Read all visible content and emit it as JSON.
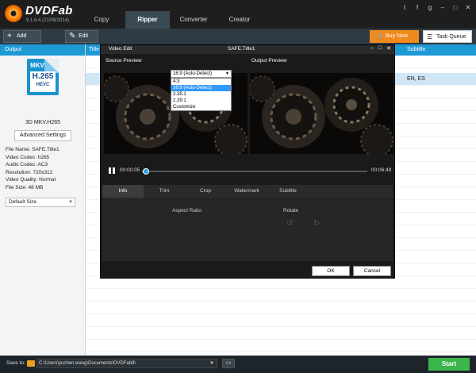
{
  "app": {
    "name": "DVDFab",
    "version": "9.1.6.4 (21/08/2014)"
  },
  "main_tabs": [
    "Copy",
    "Ripper",
    "Converter",
    "Creator"
  ],
  "social_icons": [
    "twitter-icon",
    "facebook-icon",
    "google-plus-icon",
    "minimize-icon",
    "maximize-icon",
    "close-icon"
  ],
  "toolbar": {
    "add_label": "Add",
    "edit_label": "Edit",
    "buy_label": "Buy Now",
    "task_queue_label": "Task Queue"
  },
  "left_panel": {
    "header": "Output",
    "badge_top": "MKV",
    "badge_main": "H.265",
    "badge_sub": "HEVC",
    "profile_name": "3D MKV.H265",
    "advanced_button": "Advanced Settings",
    "info": [
      "File Name: SAFE.Title1",
      "Video Codec: h265",
      "Audio Codec: AC3",
      "Resolution: 720x312",
      "Video Quality: Normal",
      "File Size: 48 MB"
    ],
    "size_select": "Default Size"
  },
  "list": {
    "col_title": "Title",
    "col_subtitle": "Subtitle",
    "row_subtitle": "EN, ES"
  },
  "dialog": {
    "name": "Video Edit",
    "title": "SAFE.Title1",
    "source_label": "Source Preview",
    "output_label": "Output Preview",
    "time_current": "00:00:05",
    "time_total": "00:06:49",
    "progress": 0.01,
    "tabs": [
      "Info",
      "Trim",
      "Crop",
      "Watermark",
      "Subtitle"
    ],
    "active_tab": "Info",
    "aspect_ratio_label": "Aspect Ratio",
    "rotate_label": "Rotate",
    "aspect_selected": "16:9 (Auto-Detect)",
    "aspect_options": [
      "4:3",
      "16:9 (Auto-Detect)",
      "2.35:1",
      "2.39:1",
      "Customize"
    ],
    "ok_label": "OK",
    "cancel_label": "Cancel"
  },
  "bottom": {
    "save_to_label": "Save to:",
    "path": "C:\\Users\\yuchen.wang\\Documents\\DVDFab9\\",
    "start_label": "Start"
  },
  "colors": {
    "accent_blue": "#1d9ad6",
    "buy_orange": "#f08a1c",
    "start_green": "#3cb54a",
    "dark_bg": "#1e1e1e"
  }
}
